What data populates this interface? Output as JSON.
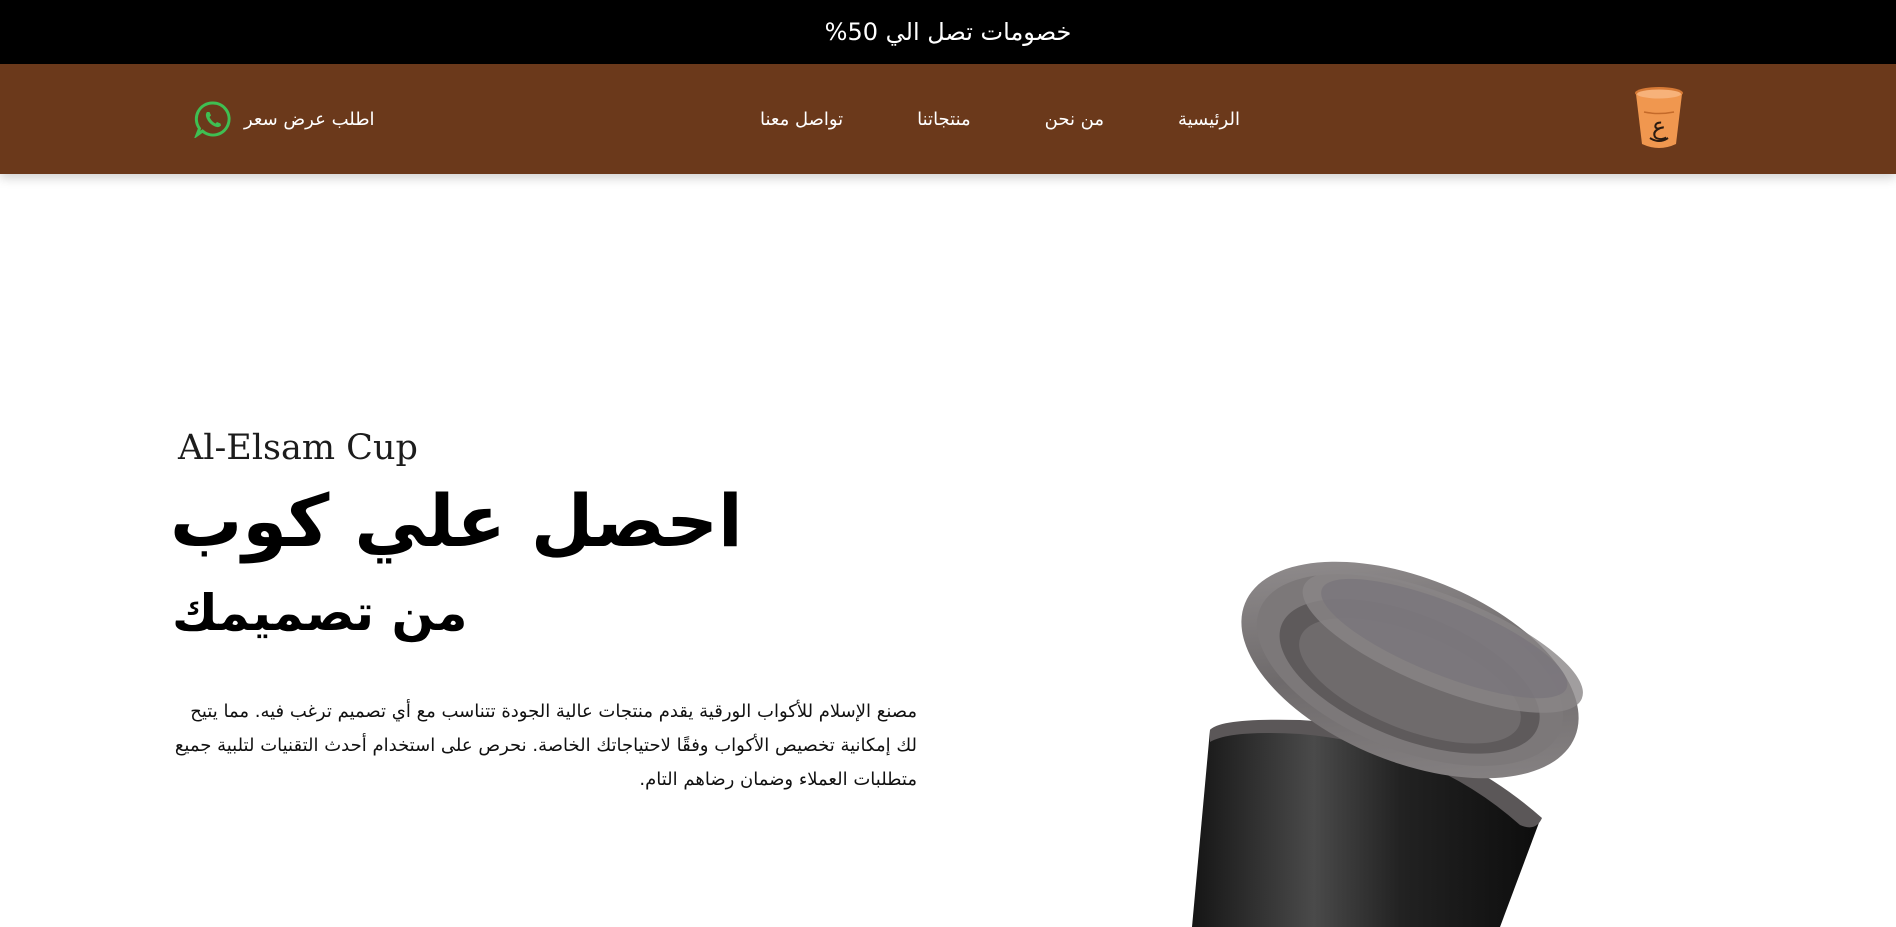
{
  "promo": {
    "text": "خصومات تصل الي 50%"
  },
  "nav": {
    "links": [
      {
        "label": "الرئيسية"
      },
      {
        "label": "من نحن"
      },
      {
        "label": "منتجاتنا"
      },
      {
        "label": "تواصل معنا"
      }
    ],
    "quote_label": "اطلب عرض سعر",
    "logo_letter": "ع"
  },
  "hero": {
    "brand": "Al-Elsam Cup",
    "title": "احصل علي كوب",
    "subtitle": "من تصميمك",
    "description": "مصنع الإسلام للأكواب الورقية يقدم منتجات عالية الجودة تتناسب مع أي تصميم ترغب فيه. مما يتيح لك إمكانية تخصيص الأكواب وفقًا لاحتياجاتك الخاصة. نحرص على استخدام أحدث التقنيات لتلبية جميع متطلبات العملاء وضمان رضاهم التام."
  },
  "icons": {
    "logo": "cup-logo-icon",
    "whatsapp": "whatsapp-icon",
    "hero_image": "paper-cup-with-lid-illustration"
  },
  "colors": {
    "promo_bg": "#000000",
    "nav_bg": "#6b391b",
    "logo_orange": "#f0974f",
    "whatsapp_green": "#3fbf52",
    "text_dark": "#000000"
  }
}
